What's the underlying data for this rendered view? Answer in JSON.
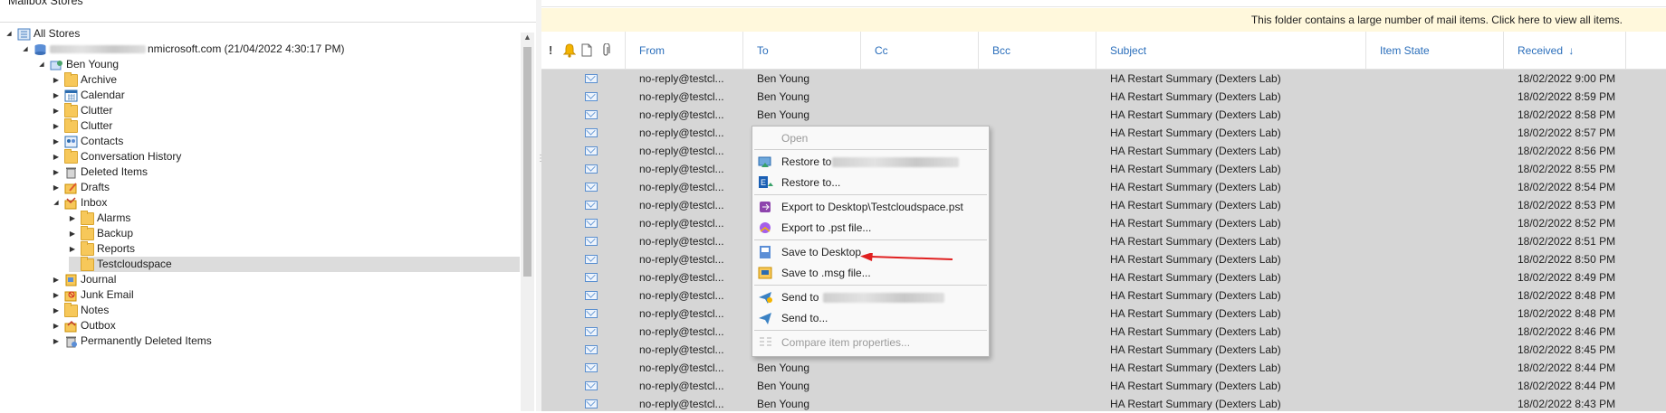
{
  "left_pane": {
    "title": "Mailbox Stores",
    "tree": [
      {
        "label": "All Stores",
        "icon": "stores-icon",
        "level": 0,
        "expander": "expanded"
      },
      {
        "label": "nmicrosoft.com (21/04/2022 4:30:17 PM)",
        "icon": "database-icon",
        "level": 1,
        "expander": "expanded",
        "blurred_prefix": true
      },
      {
        "label": "Ben Young",
        "icon": "mailbox-user-icon",
        "level": 2,
        "expander": "expanded"
      },
      {
        "label": "Archive",
        "icon": "folder-icon",
        "level": 3,
        "expander": "collapsed"
      },
      {
        "label": "Calendar",
        "icon": "calendar-icon",
        "level": 3,
        "expander": "collapsed"
      },
      {
        "label": "Clutter",
        "icon": "folder-icon",
        "level": 3,
        "expander": "collapsed"
      },
      {
        "label": "Clutter",
        "icon": "folder-icon",
        "level": 3,
        "expander": "collapsed"
      },
      {
        "label": "Contacts",
        "icon": "contacts-icon",
        "level": 3,
        "expander": "collapsed"
      },
      {
        "label": "Conversation History",
        "icon": "folder-icon",
        "level": 3,
        "expander": "collapsed"
      },
      {
        "label": "Deleted Items",
        "icon": "trash-icon",
        "level": 3,
        "expander": "collapsed"
      },
      {
        "label": "Drafts",
        "icon": "drafts-icon",
        "level": 3,
        "expander": "collapsed"
      },
      {
        "label": "Inbox",
        "icon": "inbox-icon",
        "level": 3,
        "expander": "expanded"
      },
      {
        "label": "Alarms",
        "icon": "folder-icon",
        "level": 4,
        "expander": "collapsed"
      },
      {
        "label": "Backup",
        "icon": "folder-icon",
        "level": 4,
        "expander": "collapsed"
      },
      {
        "label": "Reports",
        "icon": "folder-icon",
        "level": 4,
        "expander": "collapsed"
      },
      {
        "label": "Testcloudspace",
        "icon": "folder-icon",
        "level": 4,
        "expander": "none",
        "selected": true
      },
      {
        "label": "Journal",
        "icon": "journal-icon",
        "level": 3,
        "expander": "collapsed"
      },
      {
        "label": "Junk Email",
        "icon": "junk-icon",
        "level": 3,
        "expander": "collapsed"
      },
      {
        "label": "Notes",
        "icon": "folder-icon",
        "level": 3,
        "expander": "collapsed"
      },
      {
        "label": "Outbox",
        "icon": "outbox-icon",
        "level": 3,
        "expander": "collapsed"
      },
      {
        "label": "Permanently Deleted Items",
        "icon": "permanent-trash-icon",
        "level": 3,
        "expander": "collapsed"
      }
    ]
  },
  "infobar": {
    "text": "This folder contains a large number of mail items. Click here to view all items."
  },
  "columns": {
    "from": "From",
    "to": "To",
    "cc": "Cc",
    "bcc": "Bcc",
    "subject": "Subject",
    "item_state": "Item State",
    "received": "Received",
    "sort_indicator": "↓"
  },
  "rows": [
    {
      "from": "no-reply@testcl...",
      "to": "Ben Young",
      "subject": "HA Restart Summary (Dexters Lab)",
      "received": "18/02/2022 9:00 PM"
    },
    {
      "from": "no-reply@testcl...",
      "to": "Ben Young",
      "subject": "HA Restart Summary (Dexters Lab)",
      "received": "18/02/2022 8:59 PM"
    },
    {
      "from": "no-reply@testcl...",
      "to": "Ben Young",
      "subject": "HA Restart Summary (Dexters Lab)",
      "received": "18/02/2022 8:58 PM"
    },
    {
      "from": "no-reply@testcl...",
      "to": "",
      "subject": "HA Restart Summary (Dexters Lab)",
      "received": "18/02/2022 8:57 PM"
    },
    {
      "from": "no-reply@testcl...",
      "to": "",
      "subject": "HA Restart Summary (Dexters Lab)",
      "received": "18/02/2022 8:56 PM"
    },
    {
      "from": "no-reply@testcl...",
      "to": "",
      "subject": "HA Restart Summary (Dexters Lab)",
      "received": "18/02/2022 8:55 PM"
    },
    {
      "from": "no-reply@testcl...",
      "to": "",
      "subject": "HA Restart Summary (Dexters Lab)",
      "received": "18/02/2022 8:54 PM"
    },
    {
      "from": "no-reply@testcl...",
      "to": "",
      "subject": "HA Restart Summary (Dexters Lab)",
      "received": "18/02/2022 8:53 PM"
    },
    {
      "from": "no-reply@testcl...",
      "to": "",
      "subject": "HA Restart Summary (Dexters Lab)",
      "received": "18/02/2022 8:52 PM"
    },
    {
      "from": "no-reply@testcl...",
      "to": "",
      "subject": "HA Restart Summary (Dexters Lab)",
      "received": "18/02/2022 8:51 PM"
    },
    {
      "from": "no-reply@testcl...",
      "to": "",
      "subject": "HA Restart Summary (Dexters Lab)",
      "received": "18/02/2022 8:50 PM"
    },
    {
      "from": "no-reply@testcl...",
      "to": "",
      "subject": "HA Restart Summary (Dexters Lab)",
      "received": "18/02/2022 8:49 PM"
    },
    {
      "from": "no-reply@testcl...",
      "to": "",
      "subject": "HA Restart Summary (Dexters Lab)",
      "received": "18/02/2022 8:48 PM"
    },
    {
      "from": "no-reply@testcl...",
      "to": "",
      "subject": "HA Restart Summary (Dexters Lab)",
      "received": "18/02/2022 8:48 PM"
    },
    {
      "from": "no-reply@testcl...",
      "to": "",
      "subject": "HA Restart Summary (Dexters Lab)",
      "received": "18/02/2022 8:46 PM"
    },
    {
      "from": "no-reply@testcl...",
      "to": "",
      "subject": "HA Restart Summary (Dexters Lab)",
      "received": "18/02/2022 8:45 PM"
    },
    {
      "from": "no-reply@testcl...",
      "to": "Ben Young",
      "subject": "HA Restart Summary (Dexters Lab)",
      "received": "18/02/2022 8:44 PM"
    },
    {
      "from": "no-reply@testcl...",
      "to": "Ben Young",
      "subject": "HA Restart Summary (Dexters Lab)",
      "received": "18/02/2022 8:44 PM"
    },
    {
      "from": "no-reply@testcl...",
      "to": "Ben Young",
      "subject": "HA Restart Summary (Dexters Lab)",
      "received": "18/02/2022 8:43 PM"
    }
  ],
  "context_menu": {
    "open": "Open",
    "restore_to_user": "Restore to",
    "restore_to": "Restore to...",
    "export_desktop_pst": "Export to Desktop\\Testcloudspace.pst",
    "export_pst": "Export to .pst file...",
    "save_desktop": "Save to Desktop",
    "save_msg": "Save to .msg file...",
    "send_to_user": "Send to",
    "send_to": "Send to...",
    "compare": "Compare item properties..."
  },
  "colors": {
    "accent": "#2a6ebb",
    "grid_background": "#d6d6d6",
    "infobar_background": "#fff8dc",
    "annotation_arrow": "#e02020"
  }
}
